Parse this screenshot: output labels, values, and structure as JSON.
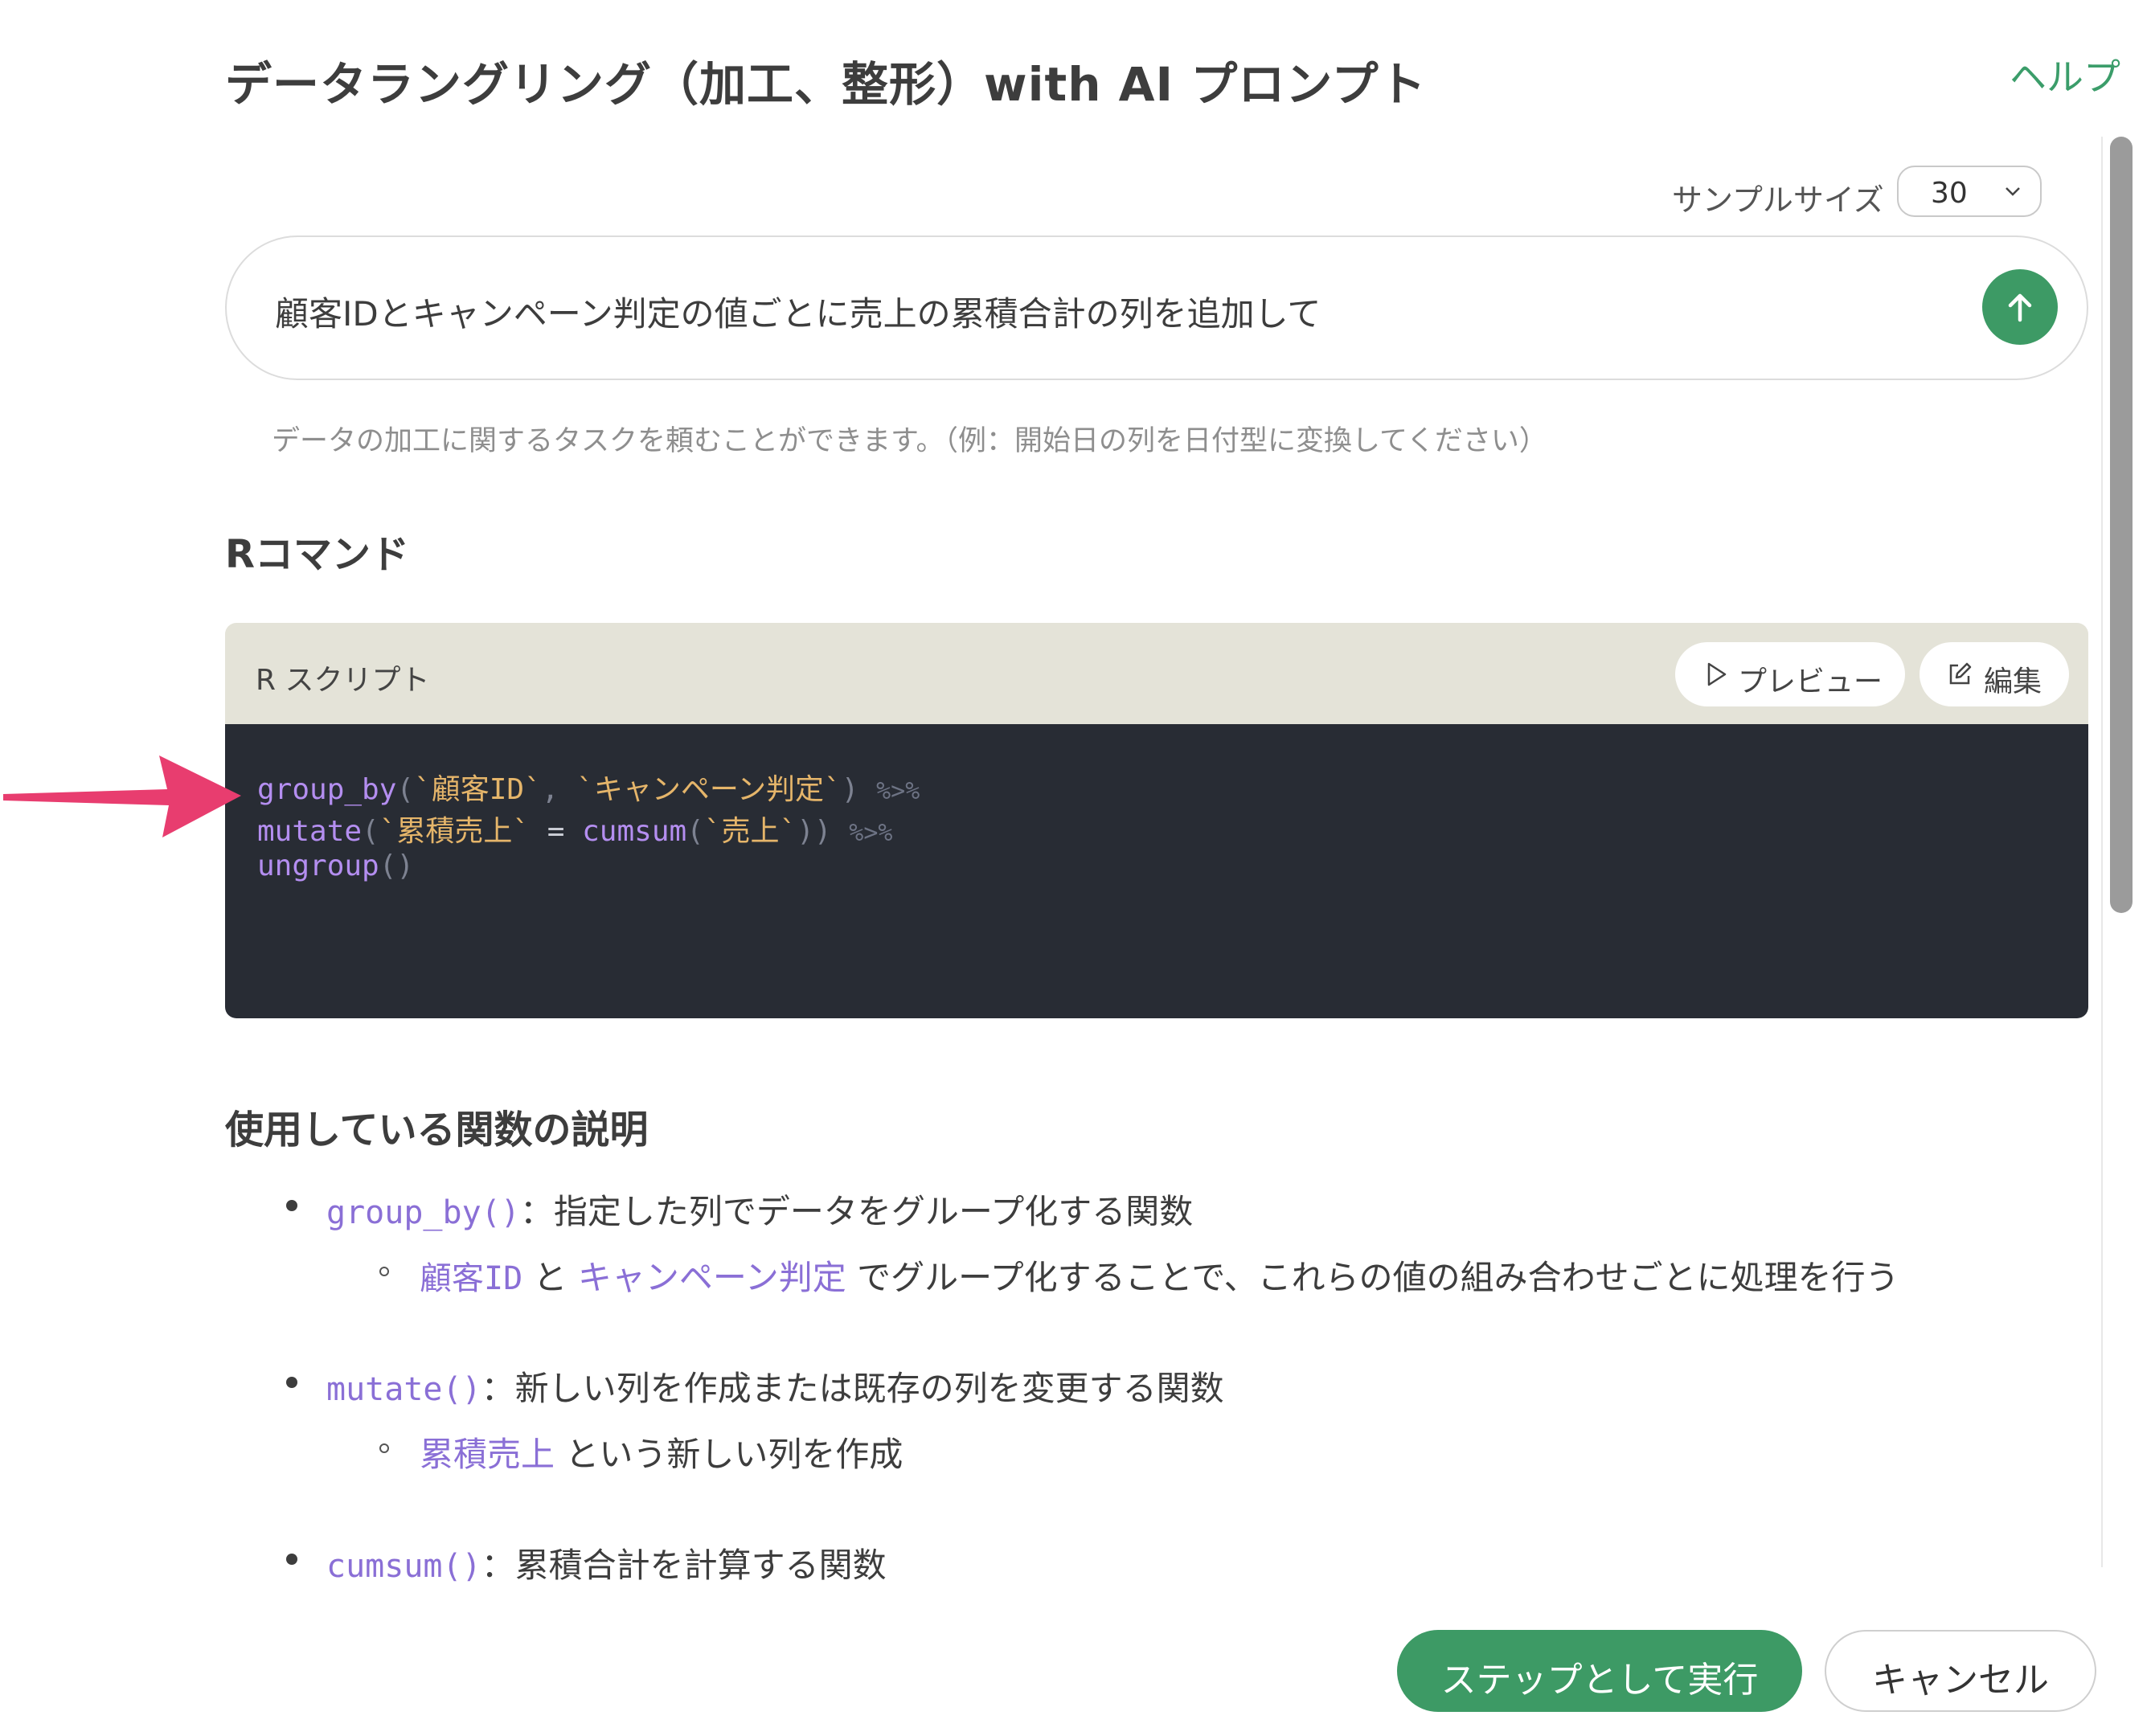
{
  "header": {
    "title": "データラングリング（加工、整形）with AI プロンプト",
    "help_link": "ヘルプ"
  },
  "sample": {
    "label": "サンプルサイズ",
    "value": "30"
  },
  "prompt": {
    "text": "顧客IDとキャンペーン判定の値ごとに売上の累積合計の列を追加して",
    "hint": "データの加工に関するタスクを頼むことができます。（例：開始日の列を日付型に変換してください）"
  },
  "r_command": {
    "heading": "Rコマンド",
    "script_label": "R スクリプト",
    "preview_button": "プレビュー",
    "edit_button": "編集",
    "code": {
      "line1": {
        "fn": "group_by",
        "open": "(",
        "arg1": "`顧客ID`",
        "sep": ", ",
        "arg2": "`キャンペーン判定`",
        "close": ")",
        "pipe": "%>%"
      },
      "line2": {
        "fn": "mutate",
        "open": "(",
        "arg1": "`累積売上`",
        "eq": " = ",
        "fn2": "cumsum",
        "open2": "(",
        "arg2": "`売上`",
        "close": "))",
        "pipe": "%>%"
      },
      "line3": {
        "fn": "ungroup",
        "parens": "()"
      }
    }
  },
  "description": {
    "heading": "使用している関数の説明",
    "items": [
      {
        "fn": "group_by()",
        "text": "：指定した列でデータをグループ化する関数",
        "sub": {
          "t1": "顧客ID",
          "t2": " と ",
          "t3": "キャンペーン判定",
          "t4": " でグループ化することで、これらの値の組み合わせごとに処理を行う"
        }
      },
      {
        "fn": "mutate()",
        "text": "：新しい列を作成または既存の列を変更する関数",
        "sub": {
          "t1": "累積売上",
          "t2": " という新しい列を作成"
        }
      },
      {
        "fn": "cumsum()",
        "text": "：累積合計を計算する関数"
      }
    ]
  },
  "footer": {
    "run_button": "ステップとして実行",
    "cancel_button": "キャンセル"
  },
  "colors": {
    "accent_green": "#3d9a65",
    "code_bg": "#282c34",
    "script_header_bg": "#e4e3d8",
    "annotation_arrow": "#e83d6f"
  }
}
